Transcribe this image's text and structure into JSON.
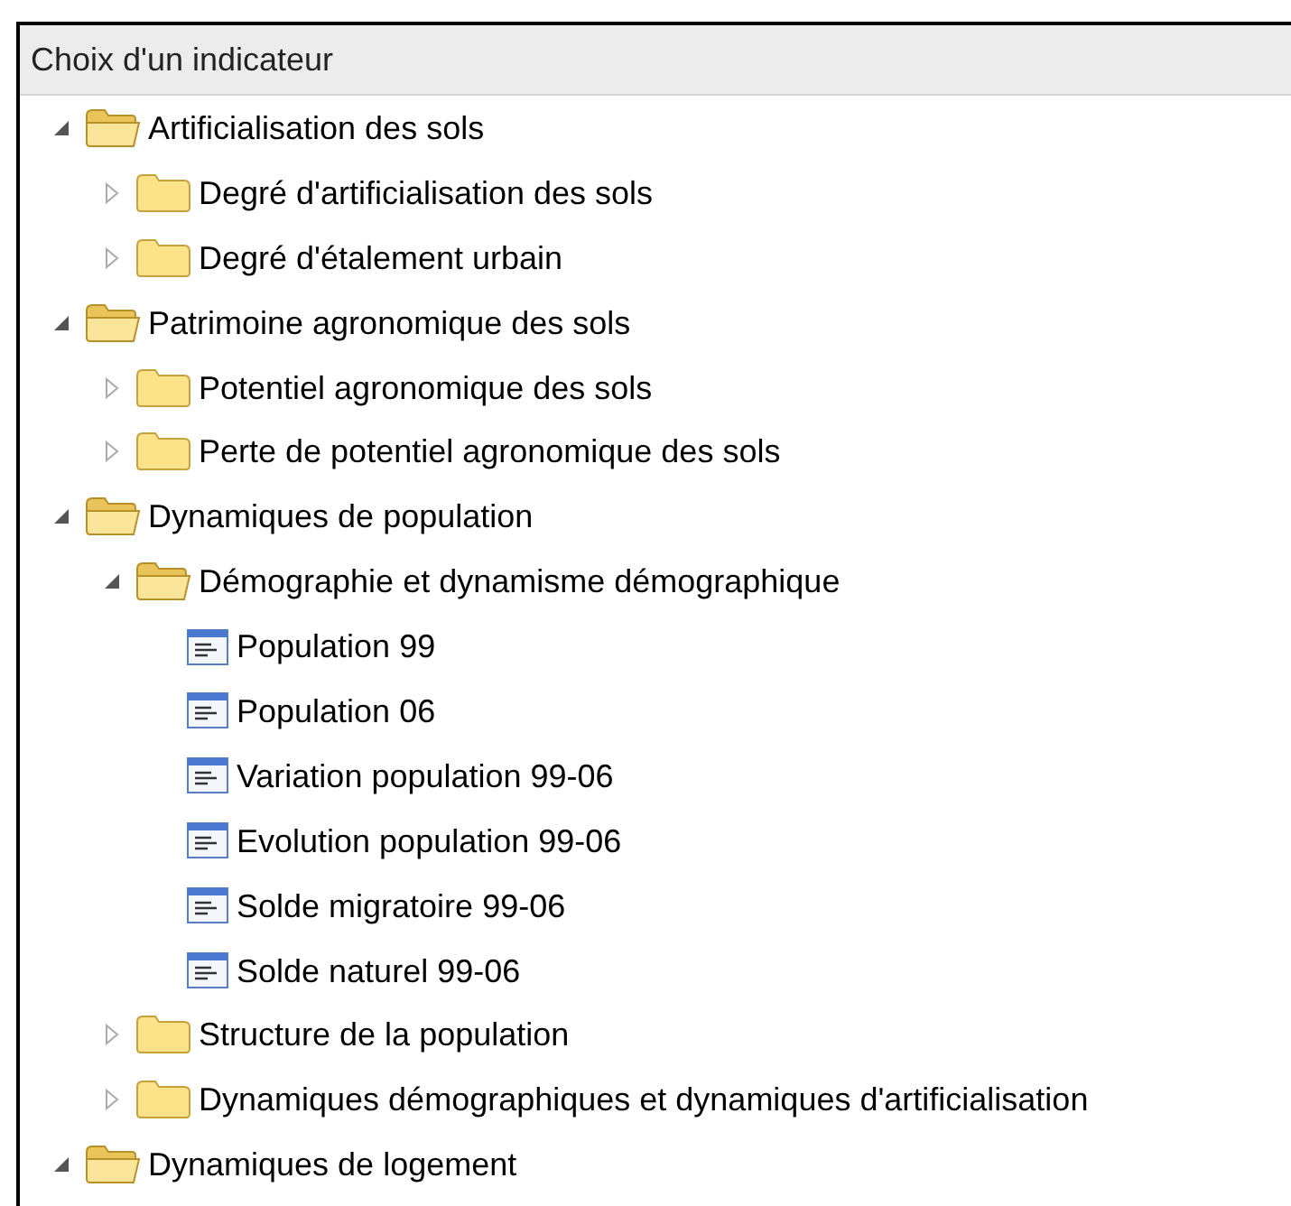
{
  "panel": {
    "title": "Choix d'un indicateur"
  },
  "tree": [
    {
      "label": "Artificialisation des sols",
      "kind": "folder",
      "expanded": true,
      "children": [
        {
          "label": "Degré d'artificialisation des sols",
          "kind": "folder",
          "expanded": false
        },
        {
          "label": "Degré d'étalement urbain",
          "kind": "folder",
          "expanded": false
        }
      ]
    },
    {
      "label": "Patrimoine agronomique des sols",
      "kind": "folder",
      "expanded": true,
      "children": [
        {
          "label": "Potentiel agronomique des sols",
          "kind": "folder",
          "expanded": false
        },
        {
          "label": "Perte de potentiel agronomique des sols",
          "kind": "folder",
          "expanded": false
        }
      ]
    },
    {
      "label": "Dynamiques de population",
      "kind": "folder",
      "expanded": true,
      "children": [
        {
          "label": "Démographie et dynamisme démographique",
          "kind": "folder",
          "expanded": true,
          "children": [
            {
              "label": "Population 99",
              "kind": "indicator"
            },
            {
              "label": "Population 06",
              "kind": "indicator"
            },
            {
              "label": "Variation population 99-06",
              "kind": "indicator"
            },
            {
              "label": "Evolution population 99-06",
              "kind": "indicator"
            },
            {
              "label": "Solde migratoire 99-06",
              "kind": "indicator"
            },
            {
              "label": "Solde naturel 99-06",
              "kind": "indicator"
            }
          ]
        },
        {
          "label": "Structure de la population",
          "kind": "folder",
          "expanded": false
        },
        {
          "label": "Dynamiques démographiques et dynamiques d'artificialisation",
          "kind": "folder",
          "expanded": false
        }
      ]
    },
    {
      "label": "Dynamiques de logement",
      "kind": "folder",
      "expanded": true
    }
  ]
}
